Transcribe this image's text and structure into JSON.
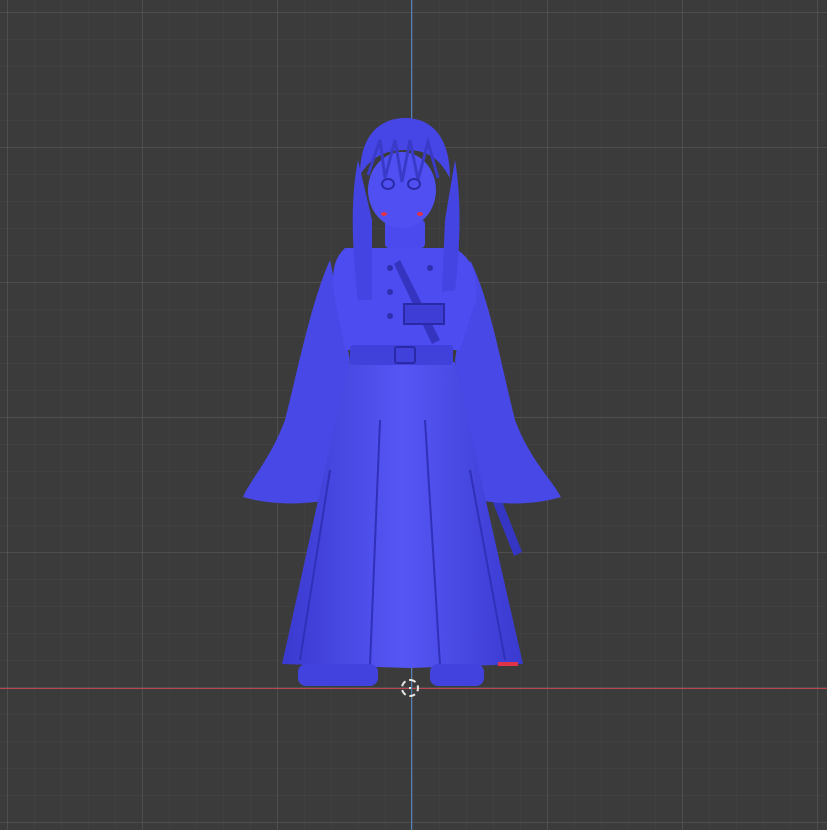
{
  "viewport": {
    "background_color": "#3b3b3b",
    "grid_color": "#5a5a5a",
    "x_axis_color": "#b8454f",
    "y_axis_color": "#4f7fbf"
  },
  "model": {
    "name": "",
    "material_color": "#4b4af0",
    "shade_color": "#3434c8",
    "highlight_color": "#6a6aff",
    "accent_color": "#e0334a"
  },
  "cursor": {
    "icon": "3d-cursor-icon"
  }
}
